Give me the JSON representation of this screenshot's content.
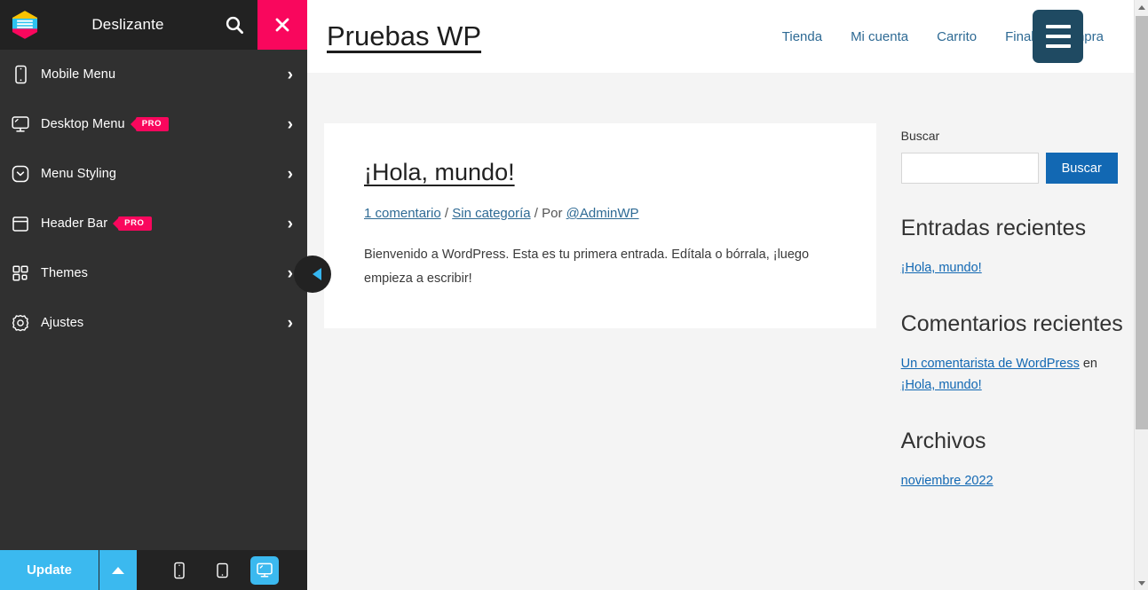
{
  "panel": {
    "logo_icon": "slider-hex-logo-icon",
    "title": "Deslizante",
    "search_icon": "search-icon",
    "close_icon": "close-icon",
    "nav_items": [
      {
        "label": "Mobile Menu",
        "icon": "mobile-phone-icon",
        "badge": "",
        "chevron": "›"
      },
      {
        "label": "Desktop Menu",
        "icon": "monitor-icon",
        "badge": "PRO",
        "chevron": "›"
      },
      {
        "label": "Menu Styling",
        "icon": "chevron-down-box-icon",
        "badge": "",
        "chevron": "›"
      },
      {
        "label": "Header Bar",
        "icon": "window-icon",
        "badge": "PRO",
        "chevron": "›"
      },
      {
        "label": "Themes",
        "icon": "grid-squares-icon",
        "badge": "",
        "chevron": "›"
      },
      {
        "label": "Ajustes",
        "icon": "gear-icon",
        "badge": "",
        "chevron": "›"
      }
    ],
    "collapse_icon": "collapse-left-arrow-icon",
    "footer": {
      "update_label": "Update",
      "up_icon": "caret-up-icon",
      "devices": [
        {
          "name": "mobile-preview",
          "icon": "mobile-phone-icon",
          "active": false
        },
        {
          "name": "tablet-preview",
          "icon": "tablet-icon",
          "active": false
        },
        {
          "name": "desktop-preview",
          "icon": "monitor-icon",
          "active": true
        }
      ]
    }
  },
  "preview": {
    "site_title": "Pruebas WP",
    "nav": [
      {
        "label": "Tienda"
      },
      {
        "label": "Mi cuenta"
      },
      {
        "label": "Carrito"
      },
      {
        "label": "Finalizar compra"
      }
    ],
    "hamburger_icon": "hamburger-menu-icon",
    "post": {
      "title": "¡Hola, mundo!",
      "meta_comments": "1 comentario",
      "meta_sep1": " / ",
      "meta_category": "Sin categoría",
      "meta_sep2": " / Por ",
      "meta_author": "@AdminWP",
      "excerpt": "Bienvenido a WordPress. Esta es tu primera entrada. Edítala o bórrala, ¡luego empieza a escribir!"
    },
    "widgets": {
      "search": {
        "label": "Buscar",
        "input_value": "",
        "input_placeholder": "",
        "button_label": "Buscar"
      },
      "recent_posts": {
        "title": "Entradas recientes",
        "items": [
          "¡Hola, mundo!"
        ]
      },
      "recent_comments": {
        "title": "Comentarios recientes",
        "author": "Un comentarista de WordPress",
        "connector": " en ",
        "post": "¡Hola, mundo!"
      },
      "archives": {
        "title": "Archivos",
        "items": [
          "noviembre 2022"
        ]
      }
    }
  },
  "colors": {
    "accent_pink": "#F9075D",
    "accent_blue": "#3BB9EF",
    "panel_bg": "#303030",
    "panel_header_bg": "#222222",
    "link_blue": "#1268B3",
    "hamburger_bg": "#1F4A62"
  }
}
